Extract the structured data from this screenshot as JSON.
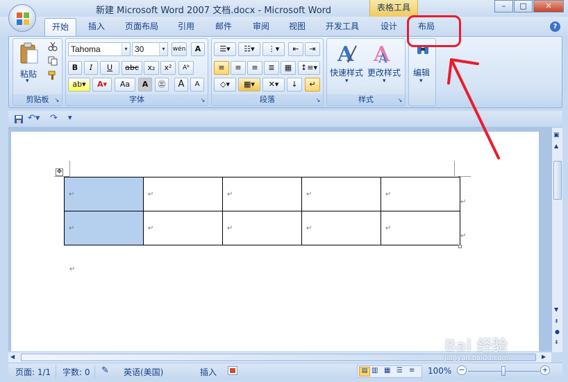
{
  "window": {
    "title": "新建 Microsoft Word 2007 文档.docx - Microsoft Word",
    "context_tab_group": "表格工具",
    "controls": {
      "minimize": "–",
      "maximize": "□",
      "close": "✕"
    }
  },
  "tabs": [
    "开始",
    "插入",
    "页面布局",
    "引用",
    "邮件",
    "审阅",
    "视图",
    "开发工具",
    "设计",
    "布局"
  ],
  "active_tab": "开始",
  "help": "?",
  "ribbon": {
    "clipboard": {
      "paste": "粘贴",
      "label": "剪贴板"
    },
    "font": {
      "name": "Tahoma",
      "size": "30",
      "label": "字体",
      "buttons": {
        "bold": "B",
        "italic": "I",
        "underline": "U",
        "strike": "abc",
        "subscript": "x₂",
        "superscript": "x²",
        "case": "Aa",
        "grow": "A",
        "shrink": "A"
      }
    },
    "paragraph": {
      "label": "段落"
    },
    "styles": {
      "quick": "快速样式",
      "change": "更改样式",
      "label": "样式"
    },
    "editing": {
      "label": "编辑"
    }
  },
  "document": {
    "table": {
      "rows": 2,
      "cols": 5,
      "cell_mark": "↵"
    },
    "paragraph_mark": "↵"
  },
  "status": {
    "page": "页面: 1/1",
    "words": "字数: 0",
    "language": "英语(美国)",
    "mode": "插入",
    "zoom": "100%",
    "zoom_minus": "−",
    "zoom_plus": "+"
  },
  "watermark": {
    "text": "Bai 经验",
    "url": "jingyan.baidu.com"
  },
  "colors": {
    "annotation": "#ea1c2e",
    "selection": "#b5d0ef",
    "ribbon": "#dbe7f6"
  }
}
